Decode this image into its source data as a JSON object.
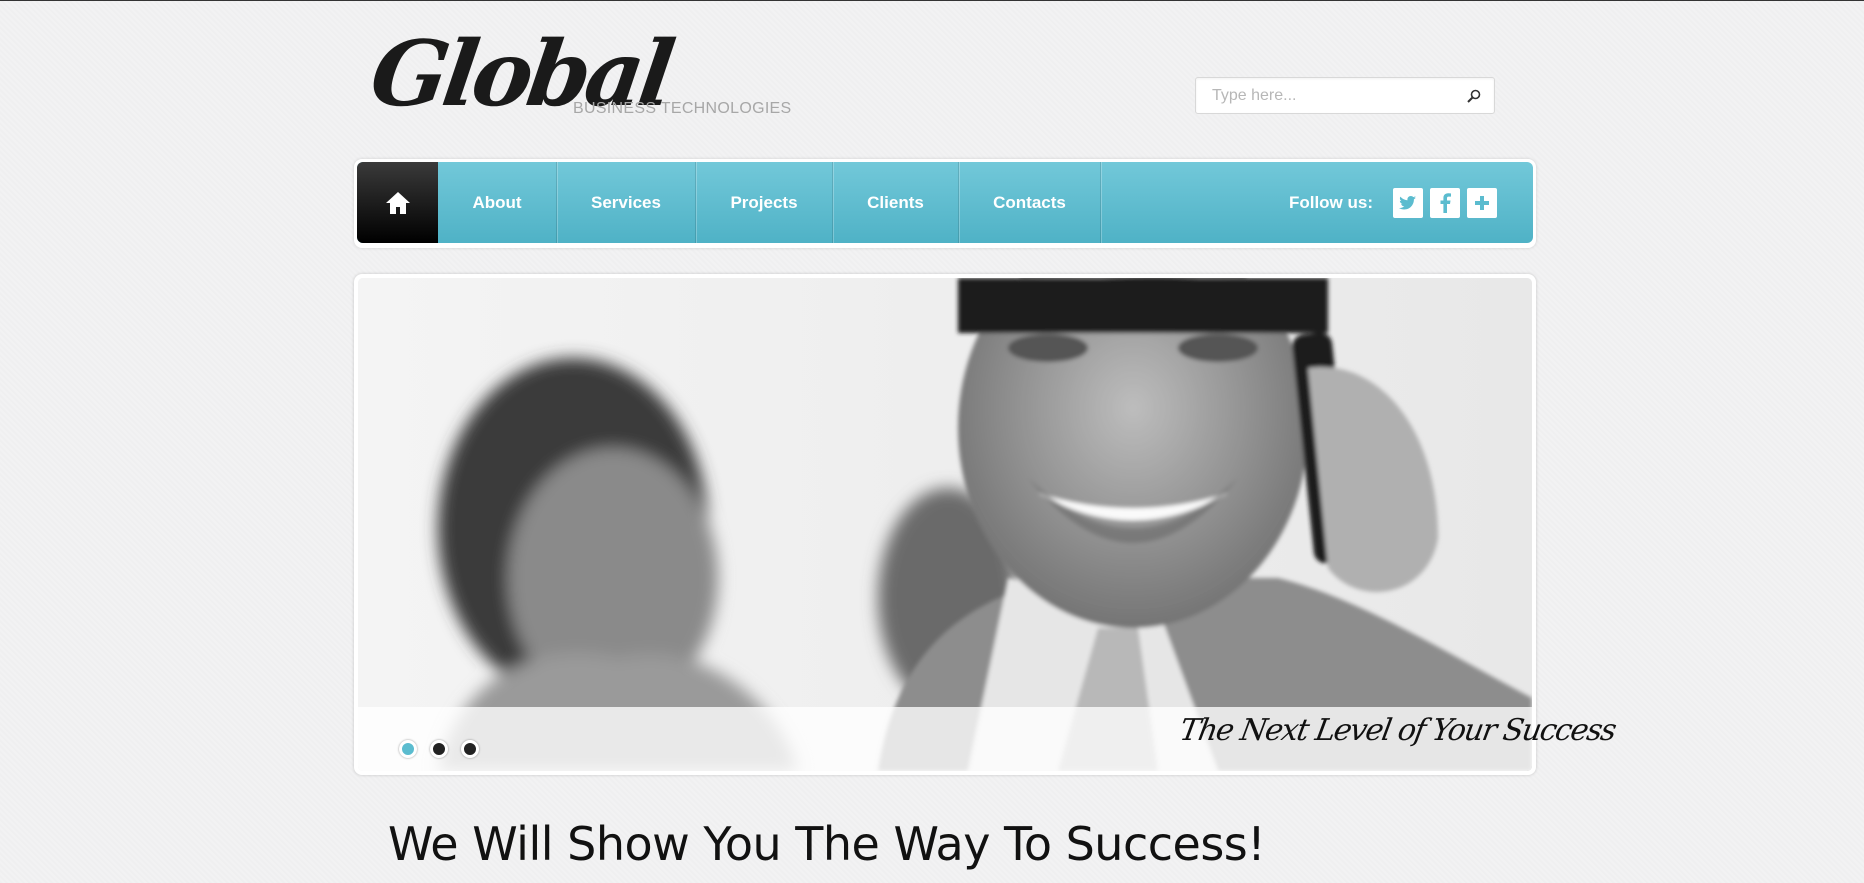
{
  "logo": {
    "text": "Global",
    "subtitle": "BUSINESS TECHNOLOGIES"
  },
  "search": {
    "placeholder": "Type here...",
    "icon": "search-icon"
  },
  "nav": {
    "home_icon": "home-icon",
    "items": [
      {
        "label": "About"
      },
      {
        "label": "Services"
      },
      {
        "label": "Projects"
      },
      {
        "label": "Clients"
      },
      {
        "label": "Contacts"
      }
    ],
    "follow_label": "Follow us:",
    "social": [
      "twitter-icon",
      "facebook-icon",
      "plus-icon"
    ]
  },
  "slider": {
    "caption": "The Next Level of Your Success",
    "active_slide": 1,
    "slide_count": 3
  },
  "headline": "We Will Show You The Way To Success!",
  "colors": {
    "accent": "#5bbccf",
    "dark": "#111111",
    "background": "#f2f2f3"
  }
}
